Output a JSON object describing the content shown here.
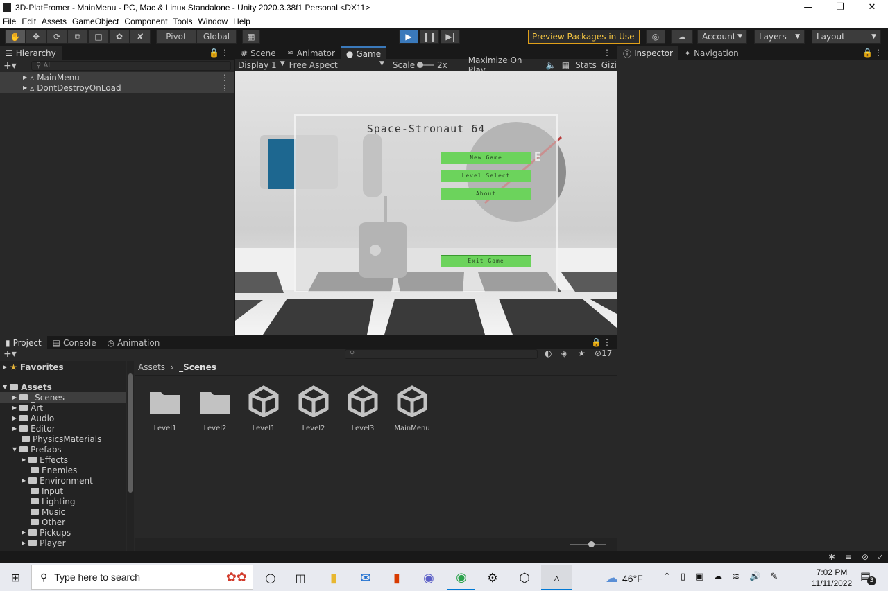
{
  "window": {
    "title": "3D-PlatFromer - MainMenu - PC, Mac & Linux Standalone - Unity 2020.3.38f1 Personal <DX11>"
  },
  "menu": [
    "File",
    "Edit",
    "Assets",
    "GameObject",
    "Component",
    "Tools",
    "Window",
    "Help"
  ],
  "toolbar": {
    "pivot": "Pivot",
    "global": "Global",
    "preview": "Preview Packages in Use",
    "account": "Account",
    "layers": "Layers",
    "layout": "Layout"
  },
  "hierarchy": {
    "tab": "Hierarchy",
    "search_placeholder": "All",
    "items": [
      "MainMenu",
      "DontDestroyOnLoad"
    ]
  },
  "center_tabs": [
    "Scene",
    "Animator",
    "Game"
  ],
  "gamebar": {
    "display": "Display 1",
    "aspect": "Free Aspect",
    "scale_label": "Scale",
    "scale_value": "2x",
    "maximize": "Maximize On Play",
    "stats": "Stats",
    "gizmos": "Gizi"
  },
  "game": {
    "title": "Space-Stronaut 64",
    "logo": "S.P.A.C.E",
    "buttons": [
      "New Game",
      "Level Select",
      "About",
      "Exit Game"
    ]
  },
  "right_tabs": [
    "Inspector",
    "Navigation"
  ],
  "bottom_tabs": [
    "Project",
    "Console",
    "Animation"
  ],
  "project": {
    "hidden_count": "17",
    "breadcrumb": [
      "Assets",
      "_Scenes"
    ],
    "tree": [
      {
        "label": "Favorites",
        "level": 0
      },
      {
        "label": "Assets",
        "level": 0
      },
      {
        "label": "_Scenes",
        "level": 1
      },
      {
        "label": "Art",
        "level": 1
      },
      {
        "label": "Audio",
        "level": 1
      },
      {
        "label": "Editor",
        "level": 1
      },
      {
        "label": "PhysicsMaterials",
        "level": 1
      },
      {
        "label": "Prefabs",
        "level": 1
      },
      {
        "label": "Effects",
        "level": 2
      },
      {
        "label": "Enemies",
        "level": 2
      },
      {
        "label": "Environment",
        "level": 2
      },
      {
        "label": "Input",
        "level": 2
      },
      {
        "label": "Lighting",
        "level": 2
      },
      {
        "label": "Music",
        "level": 2
      },
      {
        "label": "Other",
        "level": 2
      },
      {
        "label": "Pickups",
        "level": 2
      },
      {
        "label": "Player",
        "level": 2
      }
    ],
    "assets": [
      {
        "label": "Level1",
        "kind": "folder"
      },
      {
        "label": "Level2",
        "kind": "folder"
      },
      {
        "label": "Level1",
        "kind": "scene"
      },
      {
        "label": "Level2",
        "kind": "scene"
      },
      {
        "label": "Level3",
        "kind": "scene"
      },
      {
        "label": "MainMenu",
        "kind": "scene"
      }
    ]
  },
  "taskbar": {
    "search_placeholder": "Type here to search",
    "weather": "46°F",
    "time": "7:02 PM",
    "date": "11/11/2022",
    "notifications": "3"
  }
}
